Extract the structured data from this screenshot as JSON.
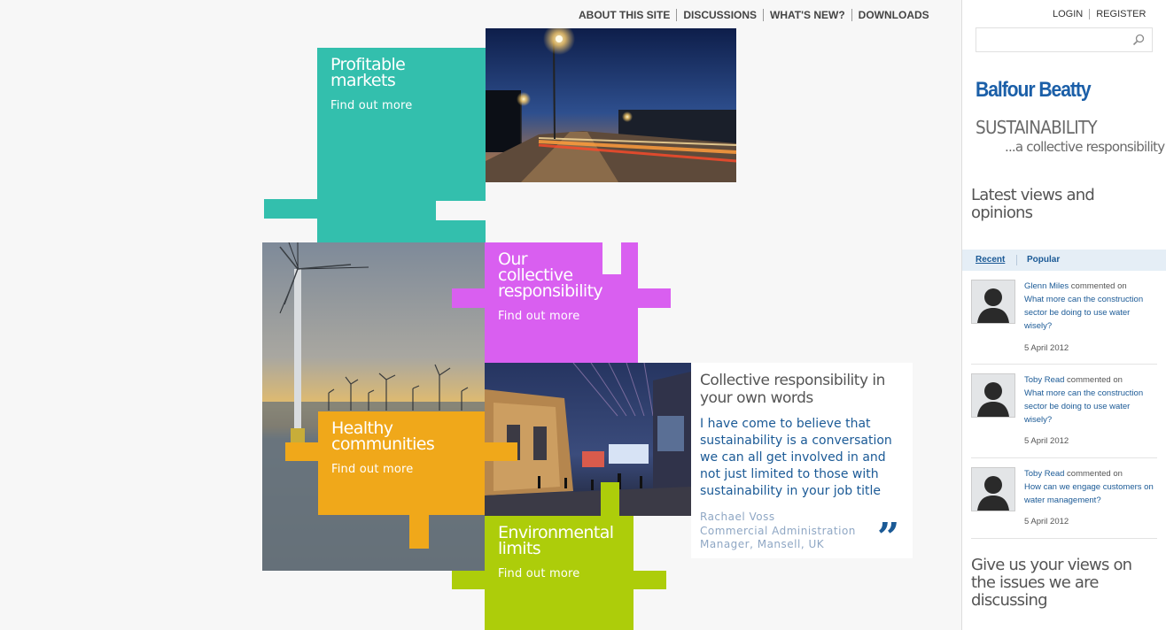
{
  "nav": {
    "items": [
      "ABOUT THIS SITE",
      "DISCUSSIONS",
      "WHAT'S NEW?",
      "DOWNLOADS"
    ]
  },
  "tiles": {
    "profitable": {
      "title": "Profitable\nmarkets",
      "link": "Find out more",
      "color": "#33bfad"
    },
    "collective": {
      "title": "Our\ncollective\nresponsibility",
      "link": "Find out more",
      "color": "#d95ff0"
    },
    "healthy": {
      "title": "Healthy\ncommunities",
      "link": "Find out more",
      "color": "#f0a81a"
    },
    "environmental": {
      "title": "Environmental\nlimits",
      "link": "Find out more",
      "color": "#adcd0a"
    }
  },
  "quote": {
    "title": "Collective responsibility in your own words",
    "text": "I have come to believe that sustainability is a conversation we can all get involved in and not just limited to those with sustainability in your job title",
    "author": "Rachael Voss",
    "role": "Commercial Administration Manager, Mansell, UK",
    "mark": "”"
  },
  "sidebar": {
    "login": "LOGIN",
    "register": "REGISTER",
    "search_placeholder": "",
    "logo": "Balfour Beatty",
    "tagline_1": "SUSTAINABILITY",
    "tagline_2": "...a collective responsibility",
    "latest_heading": "Latest views and opinions",
    "tabs": {
      "recent": "Recent",
      "popular": "Popular"
    },
    "comments": [
      {
        "name": "Glenn Miles",
        "verb": " commented on",
        "topic": "What more can the construction sector be doing to use water wisely?",
        "date": "5 April 2012"
      },
      {
        "name": "Toby Read",
        "verb": " commented on",
        "topic": "What more can the construction sector be doing to use water wisely?",
        "date": "5 April 2012"
      },
      {
        "name": "Toby Read",
        "verb": " commented on",
        "topic": "How can we engage customers on water management?",
        "date": "5 April 2012"
      }
    ],
    "give_views": "Give us your views on the issues we are discussing"
  }
}
